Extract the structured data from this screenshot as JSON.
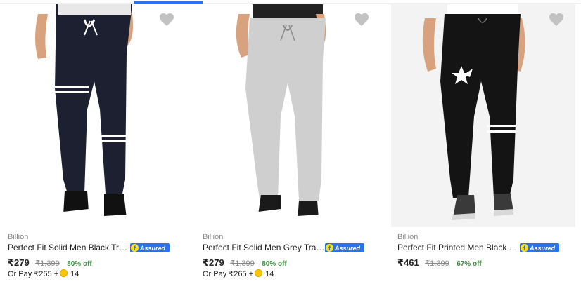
{
  "products": [
    {
      "brand": "Billion",
      "title": "Perfect Fit Solid Men Black Track Pants",
      "assured": "Assured",
      "price": "₹279",
      "mrp": "₹1,399",
      "discount": "80% off",
      "pay_prefix": "Or Pay ₹265 +",
      "coins": "14",
      "icon": "heart-icon"
    },
    {
      "brand": "Billion",
      "title": "Perfect Fit Solid Men Grey Track Pants",
      "assured": "Assured",
      "price": "₹279",
      "mrp": "₹1,399",
      "discount": "80% off",
      "pay_prefix": "Or Pay ₹265 +",
      "coins": "14",
      "icon": "heart-icon"
    },
    {
      "brand": "Billion",
      "title": "Perfect Fit Printed Men Black Track Pants",
      "assured": "Assured",
      "price": "₹461",
      "mrp": "₹1,399",
      "discount": "67% off",
      "icon": "heart-icon"
    }
  ],
  "colors": {
    "accent": "#2874f0",
    "discount": "#388e3c",
    "muted": "#878787",
    "coin": "#f9c800"
  }
}
